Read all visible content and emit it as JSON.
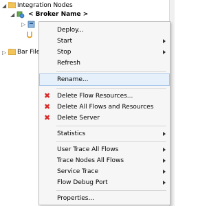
{
  "tree": {
    "root_label": "Integration Nodes",
    "broker_label": "< Broker Name >",
    "bar_files_label": "Bar File"
  },
  "menu": {
    "deploy": "Deploy...",
    "start": "Start",
    "stop": "Stop",
    "refresh": "Refresh",
    "rename": "Rename...",
    "delete_flow_resources": "Delete Flow Resources...",
    "delete_all_flows": "Delete All Flows and Resources",
    "delete_server": "Delete Server",
    "statistics": "Statistics",
    "user_trace": "User Trace All Flows",
    "trace_nodes": "Trace Nodes All Flows",
    "service_trace": "Service Trace",
    "flow_debug_port": "Flow Debug Port",
    "properties": "Properties...",
    "highlighted_item": "Rename..."
  },
  "colors": {
    "menu_background": "#f6f6f6",
    "highlight": "#e6f0fa",
    "delete_icon": "#d92b2b"
  }
}
